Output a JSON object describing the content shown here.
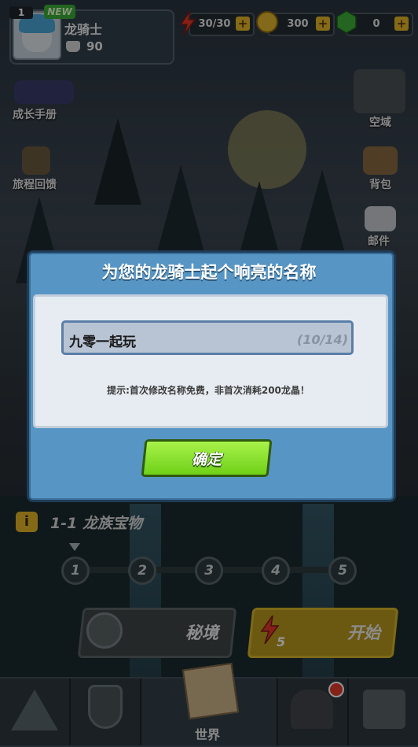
{
  "colors": {
    "accent_green": "#7bd82a",
    "dialog_blue": "#5795c4",
    "gold": "#e4b627",
    "energy_red": "#e23a2a",
    "gem_green": "#3fae3a"
  },
  "profile": {
    "level_badge": "1",
    "new_badge": "NEW",
    "name": "龙骑士",
    "score": "90",
    "score_icon": "helmet-icon"
  },
  "resources": [
    {
      "icon": "energy-bolt-icon",
      "value": "30/30"
    },
    {
      "icon": "gold-coin-icon",
      "value": "300"
    },
    {
      "icon": "green-gem-icon",
      "value": "0"
    }
  ],
  "side_left": [
    {
      "label": "成长手册",
      "icon": "growth-book-icon"
    },
    {
      "label": "旅程回馈",
      "icon": "journey-scroll-icon"
    }
  ],
  "side_right": [
    {
      "label": "空域",
      "icon": "sky-domain-icon"
    },
    {
      "label": "背包",
      "icon": "backpack-icon"
    },
    {
      "label": "邮件",
      "icon": "mail-icon"
    }
  ],
  "stage": {
    "info_icon_text": "i",
    "title": "1-1 龙族宝物",
    "nodes": [
      "1",
      "2",
      "3",
      "4",
      "5"
    ]
  },
  "actions": {
    "secret_label": "秘境",
    "start_label": "开始",
    "start_cost": "5"
  },
  "nav": {
    "world_label": "世界"
  },
  "dialog": {
    "title": "为您的龙骑士起个响亮的名称",
    "name_value": "九零一起玩",
    "name_count": "(10/14)",
    "hint": "提示:首次修改名称免费，非首次消耗200龙晶！",
    "confirm_label": "确定"
  }
}
